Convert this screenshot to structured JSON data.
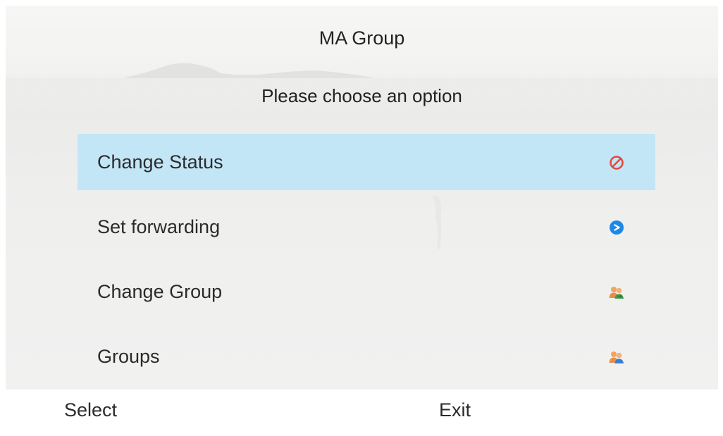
{
  "header": {
    "title": "MA Group",
    "prompt": "Please choose an option"
  },
  "menu": {
    "selected_index": 0,
    "items": [
      {
        "label": "Change Status",
        "icon": "do-not-disturb-icon",
        "selected": true
      },
      {
        "label": "Set forwarding",
        "icon": "forward-arrow-icon",
        "selected": false
      },
      {
        "label": "Change Group",
        "icon": "group-change-icon",
        "selected": false
      },
      {
        "label": "Groups",
        "icon": "groups-icon",
        "selected": false
      }
    ]
  },
  "softkeys": {
    "left": "Select",
    "right": "Exit"
  },
  "colors": {
    "selection": "#c3e6f7",
    "status_red": "#e8473c",
    "forward_blue": "#1e88e5"
  }
}
